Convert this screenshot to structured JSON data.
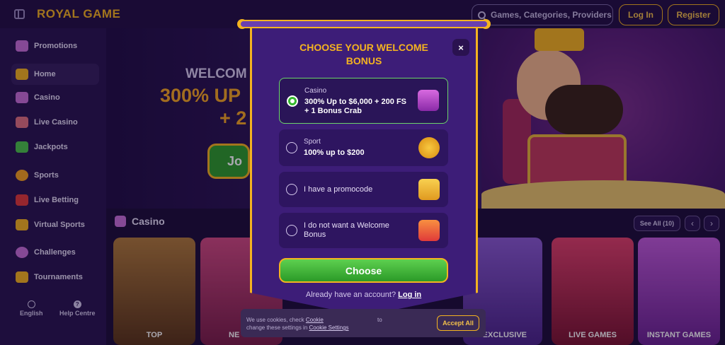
{
  "header": {
    "logo": "ROYAL GAME",
    "search_placeholder": "Games, Categories, Providers",
    "login_label": "Log In",
    "register_label": "Register"
  },
  "sidebar": {
    "items": [
      {
        "label": "Promotions",
        "icon": "gift-icon",
        "color": "#c86fd8"
      },
      {
        "label": "Home",
        "icon": "home-icon",
        "color": "#f4b320"
      },
      {
        "label": "Casino",
        "icon": "slot-icon",
        "color": "#c86fd8"
      },
      {
        "label": "Live Casino",
        "icon": "cards-icon",
        "color": "#e07080"
      },
      {
        "label": "Jackpots",
        "icon": "clover-icon",
        "color": "#4cc44a"
      },
      {
        "label": "Sports",
        "icon": "ball-icon",
        "color": "#f4a020"
      },
      {
        "label": "Live Betting",
        "icon": "live-icon",
        "color": "#e03a3a"
      },
      {
        "label": "Virtual Sports",
        "icon": "gamepad-icon",
        "color": "#f4b320"
      },
      {
        "label": "Challenges",
        "icon": "medal-icon",
        "color": "#c86fd8"
      },
      {
        "label": "Tournaments",
        "icon": "trophy-icon",
        "color": "#f4b320"
      }
    ],
    "language": "English",
    "help": "Help Centre"
  },
  "banner": {
    "title": "WELCOM",
    "line1": "300% UP",
    "line2": "+ 2",
    "button": "Jo"
  },
  "casino": {
    "heading": "Casino",
    "see_all": "See All (10)",
    "prev": "‹",
    "next": "›",
    "tiles": [
      {
        "label": "TOP",
        "color": "#8a5a2a"
      },
      {
        "label": "NE",
        "color": "#b0346a"
      },
      {
        "label": "EXCLUSIVE",
        "color": "#6a3aa8"
      },
      {
        "label": "LIVE GAMES",
        "color": "#a02a4a"
      },
      {
        "label": "INSTANT GAMES",
        "color": "#8a3aa0"
      }
    ]
  },
  "modal": {
    "title_line1": "CHOOSE YOUR WELCOME",
    "title_line2": "BONUS",
    "close": "×",
    "options": [
      {
        "small": "Casino",
        "main": "300% Up to $6,000 + 200 FS + 1 Bonus Crab",
        "selected": true,
        "icon": "slot-machine-icon"
      },
      {
        "small": "Sport",
        "main": "100% up to $200",
        "selected": false,
        "icon": "soccer-ball-icon"
      },
      {
        "plain": "I have a promocode",
        "selected": false,
        "icon": "promo-tickets-icon"
      },
      {
        "plain": "I do not want a Welcome Bonus",
        "selected": false,
        "icon": "no-gift-icon"
      }
    ],
    "choose_label": "Choose",
    "already_text": "Already have an account?",
    "login_link": "Log in"
  },
  "cookie": {
    "text_part1": "We use cookies, check",
    "link1": "Cookie",
    "text_part2": "to",
    "text_part3": "change these settings in",
    "link2": "Cookie Settings",
    "accept_label": "Accept All"
  }
}
